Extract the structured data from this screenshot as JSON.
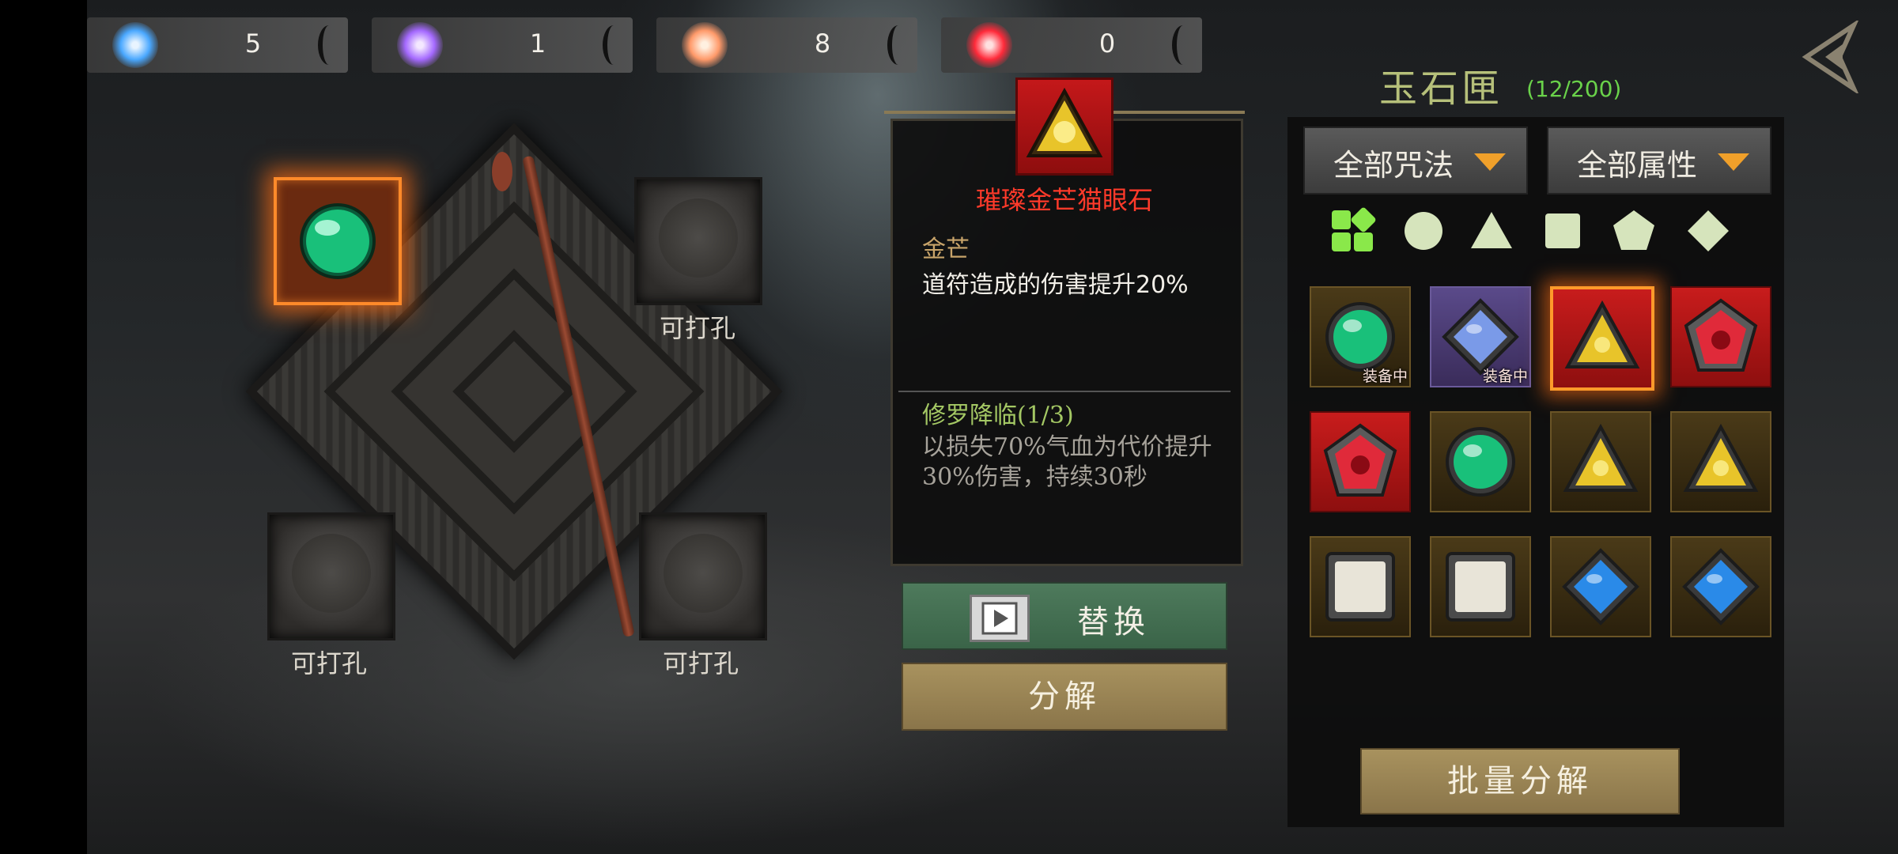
{
  "resources": [
    {
      "name": "blue-crystal",
      "color": "#4aa8ff",
      "value": "5"
    },
    {
      "name": "purple-crystal",
      "color": "#a56aff",
      "value": "1"
    },
    {
      "name": "orange-crystal",
      "color": "#ff9a6a",
      "value": "8"
    },
    {
      "name": "red-crystal",
      "color": "#ff2a3a",
      "value": "0"
    }
  ],
  "sockets": {
    "top_right_label": "可打孔",
    "bottom_left_label": "可打孔",
    "bottom_right_label": "可打孔"
  },
  "detail": {
    "gem_name": "璀璨金芒猫眼石",
    "attr_title": "金芒",
    "attr_desc": "道符造成的伤害提升20%",
    "set_title": "修罗降临(1/3)",
    "set_desc": "以损失70%气血为代价提升30%伤害，持续30秒",
    "replace_label": "替换",
    "decompose_label": "分解"
  },
  "panel": {
    "title": "玉石匣",
    "count": "(12/200)",
    "filter_spell": "全部咒法",
    "filter_attr": "全部属性",
    "batch_label": "批量分解",
    "shape_filters": [
      "all-shapes-icon",
      "circle-icon",
      "triangle-icon",
      "square-icon",
      "pentagon-icon",
      "diamond-icon"
    ],
    "equipped_tag": "装备中",
    "inventory": [
      {
        "shape": "circle",
        "color": "#19c07a",
        "bg": "gold",
        "equipped": true
      },
      {
        "shape": "diamond",
        "color": "#7a9ae8",
        "bg": "purple",
        "equipped": true
      },
      {
        "shape": "triangle",
        "color": "#e8c42a",
        "bg": "red",
        "equipped": false,
        "selected": true
      },
      {
        "shape": "pentagon",
        "color": "#e02a3a",
        "bg": "red",
        "equipped": false
      },
      {
        "shape": "pentagon",
        "color": "#e02a3a",
        "bg": "red",
        "equipped": false
      },
      {
        "shape": "circle",
        "color": "#19c07a",
        "bg": "gold",
        "equipped": false
      },
      {
        "shape": "triangle",
        "color": "#e8c42a",
        "bg": "gold",
        "equipped": false
      },
      {
        "shape": "triangle",
        "color": "#e8c42a",
        "bg": "gold",
        "equipped": false
      },
      {
        "shape": "square",
        "color": "#e8e4d8",
        "bg": "gold",
        "equipped": false
      },
      {
        "shape": "square",
        "color": "#e8e4d8",
        "bg": "gold",
        "equipped": false
      },
      {
        "shape": "diamond",
        "color": "#2a8ae8",
        "bg": "gold",
        "equipped": false
      },
      {
        "shape": "diamond",
        "color": "#2a8ae8",
        "bg": "gold",
        "equipped": false
      }
    ]
  }
}
